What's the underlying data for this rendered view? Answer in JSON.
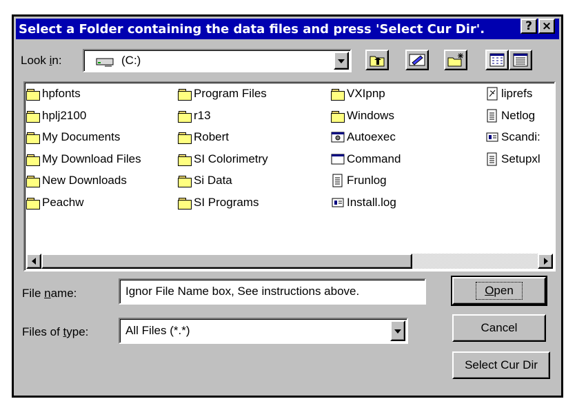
{
  "window": {
    "title": "Select a Folder containing the data files and press 'Select Cur Dir'.",
    "help_glyph": "?",
    "close_glyph": "×"
  },
  "toolbar": {
    "look_in_prefix": "Look ",
    "look_in_accel": "i",
    "look_in_suffix": "n:",
    "look_in_value": "(C:)",
    "look_in_icon": "drive-icon",
    "buttons": [
      "up-one-level-icon",
      "desktop-icon",
      "new-folder-icon",
      "list-view-icon",
      "details-view-icon"
    ]
  },
  "files": {
    "col1": [
      {
        "name": "hpfonts",
        "icon": "folder-icon"
      },
      {
        "name": "hplj2100",
        "icon": "folder-icon"
      },
      {
        "name": "My Documents",
        "icon": "folder-open-icon"
      },
      {
        "name": "My Download Files",
        "icon": "folder-icon"
      },
      {
        "name": "New Downloads",
        "icon": "folder-icon"
      },
      {
        "name": "Peachw",
        "icon": "folder-icon"
      }
    ],
    "col2": [
      {
        "name": "Program Files",
        "icon": "folder-icon"
      },
      {
        "name": "r13",
        "icon": "folder-icon"
      },
      {
        "name": "Robert",
        "icon": "folder-icon"
      },
      {
        "name": "SI Colorimetry",
        "icon": "folder-icon"
      },
      {
        "name": "Si Data",
        "icon": "folder-icon"
      },
      {
        "name": "SI Programs",
        "icon": "folder-icon"
      }
    ],
    "col3": [
      {
        "name": "VXIpnp",
        "icon": "folder-icon"
      },
      {
        "name": "Windows",
        "icon": "folder-icon"
      },
      {
        "name": "Autoexec",
        "icon": "batch-file-icon"
      },
      {
        "name": "Command",
        "icon": "application-icon"
      },
      {
        "name": "Frunlog",
        "icon": "text-file-icon"
      },
      {
        "name": "Install.log",
        "icon": "log-file-icon"
      }
    ],
    "col4": [
      {
        "name": "liprefs",
        "icon": "settings-file-icon"
      },
      {
        "name": "Netlog",
        "icon": "text-file-icon"
      },
      {
        "name": "Scandi:",
        "icon": "log-file-icon"
      },
      {
        "name": "Setupxl",
        "icon": "text-file-icon"
      }
    ]
  },
  "form": {
    "file_name_prefix": "File ",
    "file_name_accel": "n",
    "file_name_suffix": "ame:",
    "file_name_value": "Ignor File Name box, See instructions above.",
    "file_type_prefix": "Files of ",
    "file_type_accel": "t",
    "file_type_suffix": "ype:",
    "file_type_value": "All Files (*.*)"
  },
  "buttons": {
    "open_accel": "O",
    "open_rest": "pen",
    "cancel": "Cancel",
    "select_cur_dir": "Select Cur Dir"
  },
  "colors": {
    "titlebar": "#0000b0",
    "face": "#c0c0c0"
  }
}
